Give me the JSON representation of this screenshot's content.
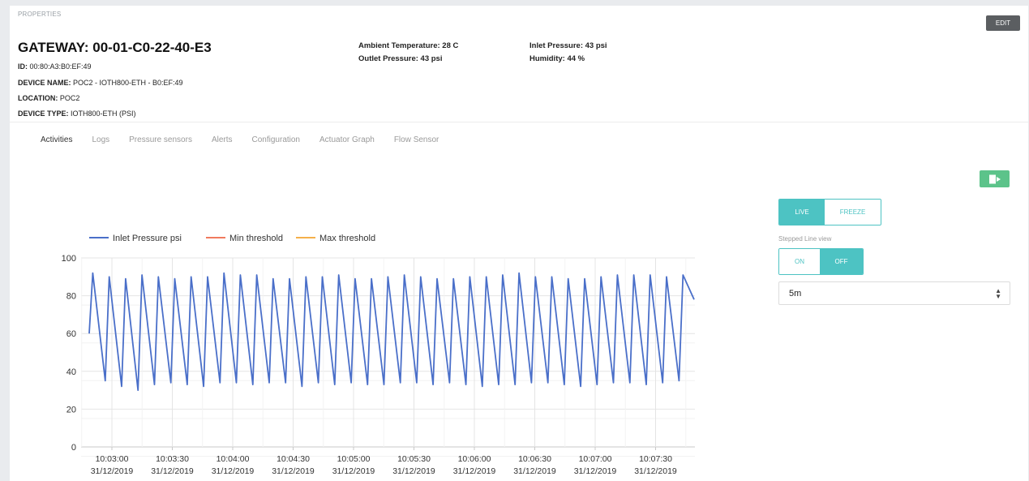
{
  "header": {
    "section_label": "PROPERTIES",
    "edit_label": "EDIT",
    "title": "GATEWAY: 00-01-C0-22-40-E3",
    "id_label": "ID:",
    "id_value": "00:80:A3:B0:EF:49",
    "device_name_label": "DEVICE NAME:",
    "device_name_value": "POC2 - IOTH800-ETH - B0:EF:49",
    "location_label": "LOCATION:",
    "location_value": "POC2",
    "device_type_label": "DEVICE TYPE:",
    "device_type_value": "IOTH800-ETH (PSI)"
  },
  "readouts": {
    "ambient_temperature": "Ambient Temperature: 28 C",
    "outlet_pressure": "Outlet Pressure: 43 psi",
    "inlet_pressure": "Inlet Pressure: 43 psi",
    "humidity": "Humidity: 44 %"
  },
  "tabs": [
    {
      "label": "Activities",
      "active": true
    },
    {
      "label": "Logs",
      "active": false
    },
    {
      "label": "Pressure sensors",
      "active": false
    },
    {
      "label": "Alerts",
      "active": false
    },
    {
      "label": "Configuration",
      "active": false
    },
    {
      "label": "Actuator Graph",
      "active": false
    },
    {
      "label": "Flow Sensor",
      "active": false
    }
  ],
  "controls": {
    "export_icon": "export-icon",
    "live_label": "LIVE",
    "freeze_label": "FREEZE",
    "live_selected": "LIVE",
    "stepped_label": "Stepped Line view",
    "on_label": "ON",
    "off_label": "OFF",
    "stepped_selected": "OFF",
    "interval_value": "5m"
  },
  "colors": {
    "accent_teal": "#4dc3c3",
    "export_green": "#5cc38a",
    "edit_gray": "#5b5e61",
    "series_blue": "#4a6fc9",
    "min_threshold": "#f07a5e",
    "max_threshold": "#f5b04a"
  },
  "chart_data": {
    "type": "line",
    "legend": [
      {
        "name": "Inlet Pressure psi",
        "color": "#4a6fc9"
      },
      {
        "name": "Min threshold",
        "color": "#f07a5e"
      },
      {
        "name": "Max threshold",
        "color": "#f5b04a"
      }
    ],
    "legend_position": "top-left",
    "ylim": [
      0,
      100
    ],
    "y_ticks": [
      "0",
      "20",
      "40",
      "60",
      "80",
      "100"
    ],
    "x_ticks": [
      {
        "time": "10:03:00",
        "date": "31/12/2019"
      },
      {
        "time": "10:03:30",
        "date": "31/12/2019"
      },
      {
        "time": "10:04:00",
        "date": "31/12/2019"
      },
      {
        "time": "10:04:30",
        "date": "31/12/2019"
      },
      {
        "time": "10:05:00",
        "date": "31/12/2019"
      },
      {
        "time": "10:05:30",
        "date": "31/12/2019"
      },
      {
        "time": "10:06:00",
        "date": "31/12/2019"
      },
      {
        "time": "10:06:30",
        "date": "31/12/2019"
      },
      {
        "time": "10:07:00",
        "date": "31/12/2019"
      },
      {
        "time": "10:07:30",
        "date": "31/12/2019"
      }
    ],
    "grid": true,
    "series": [
      {
        "name": "Inlet Pressure psi",
        "peaks": [
          92,
          90,
          89,
          91,
          90,
          89,
          90,
          90,
          92,
          91,
          91,
          89,
          89,
          90,
          90,
          91,
          89,
          89,
          90,
          91,
          90,
          89,
          89,
          90,
          90,
          91,
          92,
          90,
          90,
          89,
          89,
          90,
          91,
          91,
          91,
          90,
          91
        ],
        "troughs": [
          60,
          35,
          32,
          30,
          33,
          34,
          33,
          32,
          34,
          34,
          33,
          34,
          34,
          32,
          34,
          33,
          34,
          33,
          33,
          34,
          34,
          33,
          34,
          33,
          32,
          33,
          33,
          34,
          34,
          33,
          32,
          33,
          34,
          34,
          33,
          34,
          35
        ],
        "end_value": 78
      }
    ]
  }
}
